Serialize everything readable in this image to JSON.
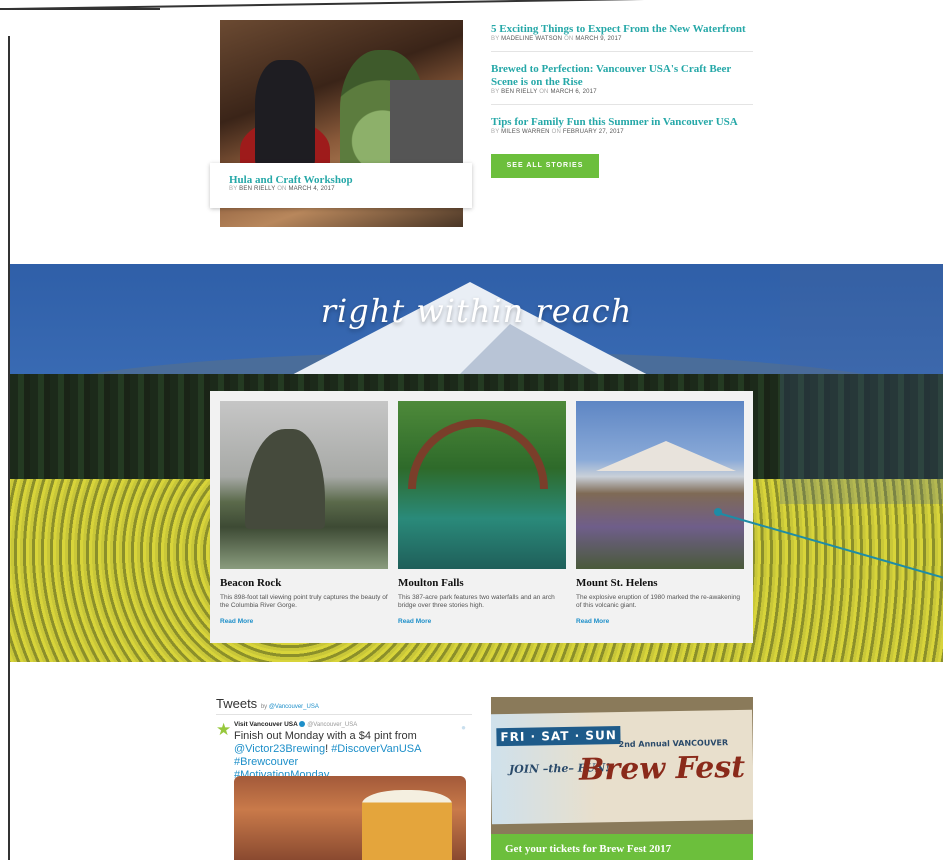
{
  "featured": {
    "title": "Hula and Craft Workshop",
    "by": "BY",
    "author": "BEN RIELLY",
    "on": "ON",
    "date": "MARCH 4, 2017"
  },
  "stories": [
    {
      "title": "5 Exciting Things to Expect From the New Waterfront",
      "by": "BY",
      "author": "MADELINE WATSON",
      "on": "ON",
      "date": "MARCH 9, 2017"
    },
    {
      "title": "Brewed to Perfection: Vancouver USA's Craft Beer Scene is on the Rise",
      "by": "BY",
      "author": "BEN RIELLY",
      "on": "ON",
      "date": "MARCH 6, 2017"
    },
    {
      "title": "Tips for Family Fun this Summer in Vancouver USA",
      "by": "BY",
      "author": "MILES WARREN",
      "on": "ON",
      "date": "FEBRUARY 27, 2017"
    }
  ],
  "see_all_label": "SEE ALL STORIES",
  "hero": {
    "heading": "right within reach",
    "places": [
      {
        "name": "Beacon Rock",
        "desc": "This 898-foot tall viewing point truly captures the beauty of the Columbia River Gorge.",
        "link": "Read More"
      },
      {
        "name": "Moulton Falls",
        "desc": "This 387-acre park features two waterfalls and an arch bridge over three stories high.",
        "link": "Read More"
      },
      {
        "name": "Mount St. Helens",
        "desc": "The explosive eruption of 1980 marked the re-awakening of this volcanic giant.",
        "link": "Read More"
      }
    ]
  },
  "tweets": {
    "heading": "Tweets",
    "by": "by",
    "handle": "@Vancouver_USA",
    "tweet": {
      "author": "Visit Vancouver USA",
      "handle": "@Vancouver_USA",
      "text_plain": "Finish out Monday with a $4 pint from",
      "link1": "@Victor23Brewing",
      "link2": "#DiscoverVanUSA",
      "link3": "#Brewcouver",
      "link4": "#MotivationMonday"
    }
  },
  "ad": {
    "days": "FRI · SAT · SUN",
    "join": "JOIN –the– FUN!",
    "subtitle": "2nd Annual VANCOUVER",
    "event": "Brew Fest",
    "cta": "Get your tickets for Brew Fest 2017"
  },
  "colors": {
    "link_teal": "#26a8a8",
    "button_green": "#6cbf3c",
    "link_blue": "#1d8fc9"
  }
}
